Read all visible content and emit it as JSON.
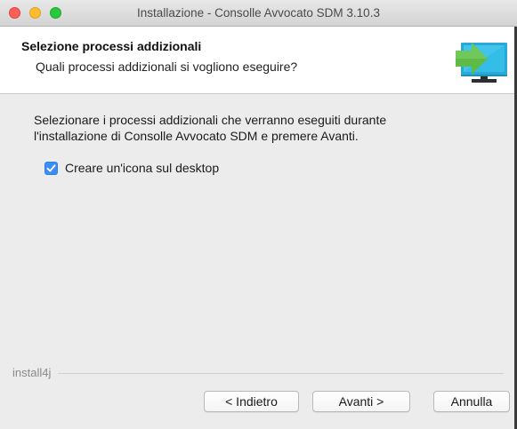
{
  "window": {
    "title": "Installazione - Consolle Avvocato SDM 3.10.3"
  },
  "header": {
    "title": "Selezione processi addizionali",
    "subtitle": "Quali processi addizionali si vogliono eseguire?",
    "icon": "monitor-arrow-icon"
  },
  "content": {
    "instructions_line1": "Selezionare i processi addizionali che verranno eseguiti durante",
    "instructions_line2": "l'installazione di Consolle Avvocato SDM e premere Avanti.",
    "options": [
      {
        "label": "Creare un'icona sul desktop",
        "checked": true
      }
    ]
  },
  "footer": {
    "brand": "install4j",
    "back_label": "< Indietro",
    "next_label": "Avanti >",
    "cancel_label": "Annulla"
  },
  "colors": {
    "accent": "#3b8ef5",
    "close": "#fc5f57",
    "minimize": "#fdbc2e",
    "maximize": "#28c840",
    "icon_arrow": "#5dbb46",
    "icon_screen": "#2aa8d8"
  }
}
